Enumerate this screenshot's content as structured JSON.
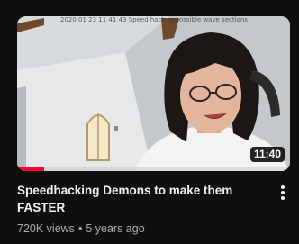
{
  "video": {
    "thumbnail_caption": "2020 01 23 11 41 43 Speed hack impossible wave sections",
    "duration": "11:40",
    "progress_fraction": 0.1,
    "title": "Speedhacking Demons to make them FASTER",
    "views": "720K views",
    "separator": "•",
    "age": "5 years ago"
  },
  "icons": {
    "more": "more-vert-icon"
  },
  "colors": {
    "background": "#0f0f0f",
    "progress": "#ff0033",
    "title_text": "#f1f1f1",
    "meta_text": "#aaaaaa"
  }
}
